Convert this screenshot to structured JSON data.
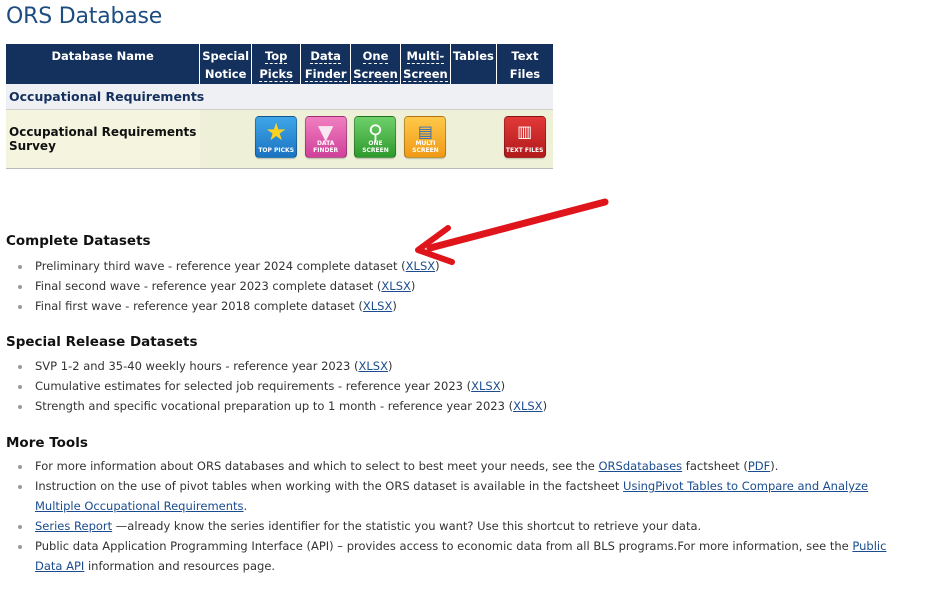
{
  "page_title": "ORS Database",
  "table": {
    "headers": {
      "db_name": "Database Name",
      "special_1": "Special",
      "special_2": "Notice",
      "top_1": "Top",
      "top_2": "Picks",
      "finder_1": "Data",
      "finder_2": "Finder",
      "one_1": "One",
      "one_2": "Screen",
      "multi_1": "Multi-",
      "multi_2": "Screen",
      "tables": "Tables",
      "text_files": "Text Files"
    },
    "group_label": "Occupational Requirements",
    "row": {
      "name": "Occupational Requirements Survey",
      "icons": {
        "top_picks": "TOP PICKS",
        "data_finder": "DATA FINDER",
        "one_screen": "ONE SCREEN",
        "multi_screen": "MULTI SCREEN",
        "text_files": "TEXT FILES"
      },
      "icon_names": [
        "star-icon",
        "funnel-icon",
        "magnifier-icon",
        "window-icon",
        "document-icon"
      ]
    }
  },
  "complete": {
    "heading": "Complete Datasets",
    "items": [
      {
        "text": "Preliminary third wave - reference year 2024 complete dataset (",
        "link": "XLSX",
        "after": ")"
      },
      {
        "text": "Final second wave - reference year 2023 complete dataset (",
        "link": "XLSX",
        "after": ")"
      },
      {
        "text": "Final first wave - reference year 2018 complete dataset (",
        "link": "XLSX",
        "after": ")"
      }
    ]
  },
  "special": {
    "heading": "Special Release Datasets",
    "items": [
      {
        "text": "SVP 1-2 and 35-40 weekly hours - reference year 2023 (",
        "link": "XLSX",
        "after": ")"
      },
      {
        "text": "Cumulative estimates for selected job requirements - reference year 2023 (",
        "link": "XLSX",
        "after": ")"
      },
      {
        "text": "Strength and specific vocational preparation up to 1 month - reference year 2023 (",
        "link": "XLSX",
        "after": ")"
      }
    ]
  },
  "tools": {
    "heading": "More Tools",
    "item1": {
      "pre": "For more information about ORS databases and which to select to best meet your needs, see the ",
      "link1": "ORSdatabases",
      "mid": " factsheet (",
      "link2": "PDF",
      "post": ")."
    },
    "item2": {
      "pre": "Instruction on the use of pivot tables when working with the ORS dataset is available in the factsheet ",
      "link": "UsingPivot Tables to Compare and Analyze Multiple Occupational Requirements",
      "post": "."
    },
    "item3": {
      "link": "Series Report",
      "post": " —already know the series identifier for the statistic you want? Use this shortcut to retrieve your data."
    },
    "item4": {
      "pre": "Public data Application Programming Interface (API) – provides access to economic data from all BLS programs.For more information, see the ",
      "link": "Public Data API",
      "post": " information and resources page."
    }
  },
  "colors": {
    "header_bg": "#14305c",
    "title": "#1d4d80",
    "link": "#1a4c8f",
    "arrow": "#e0141b"
  }
}
